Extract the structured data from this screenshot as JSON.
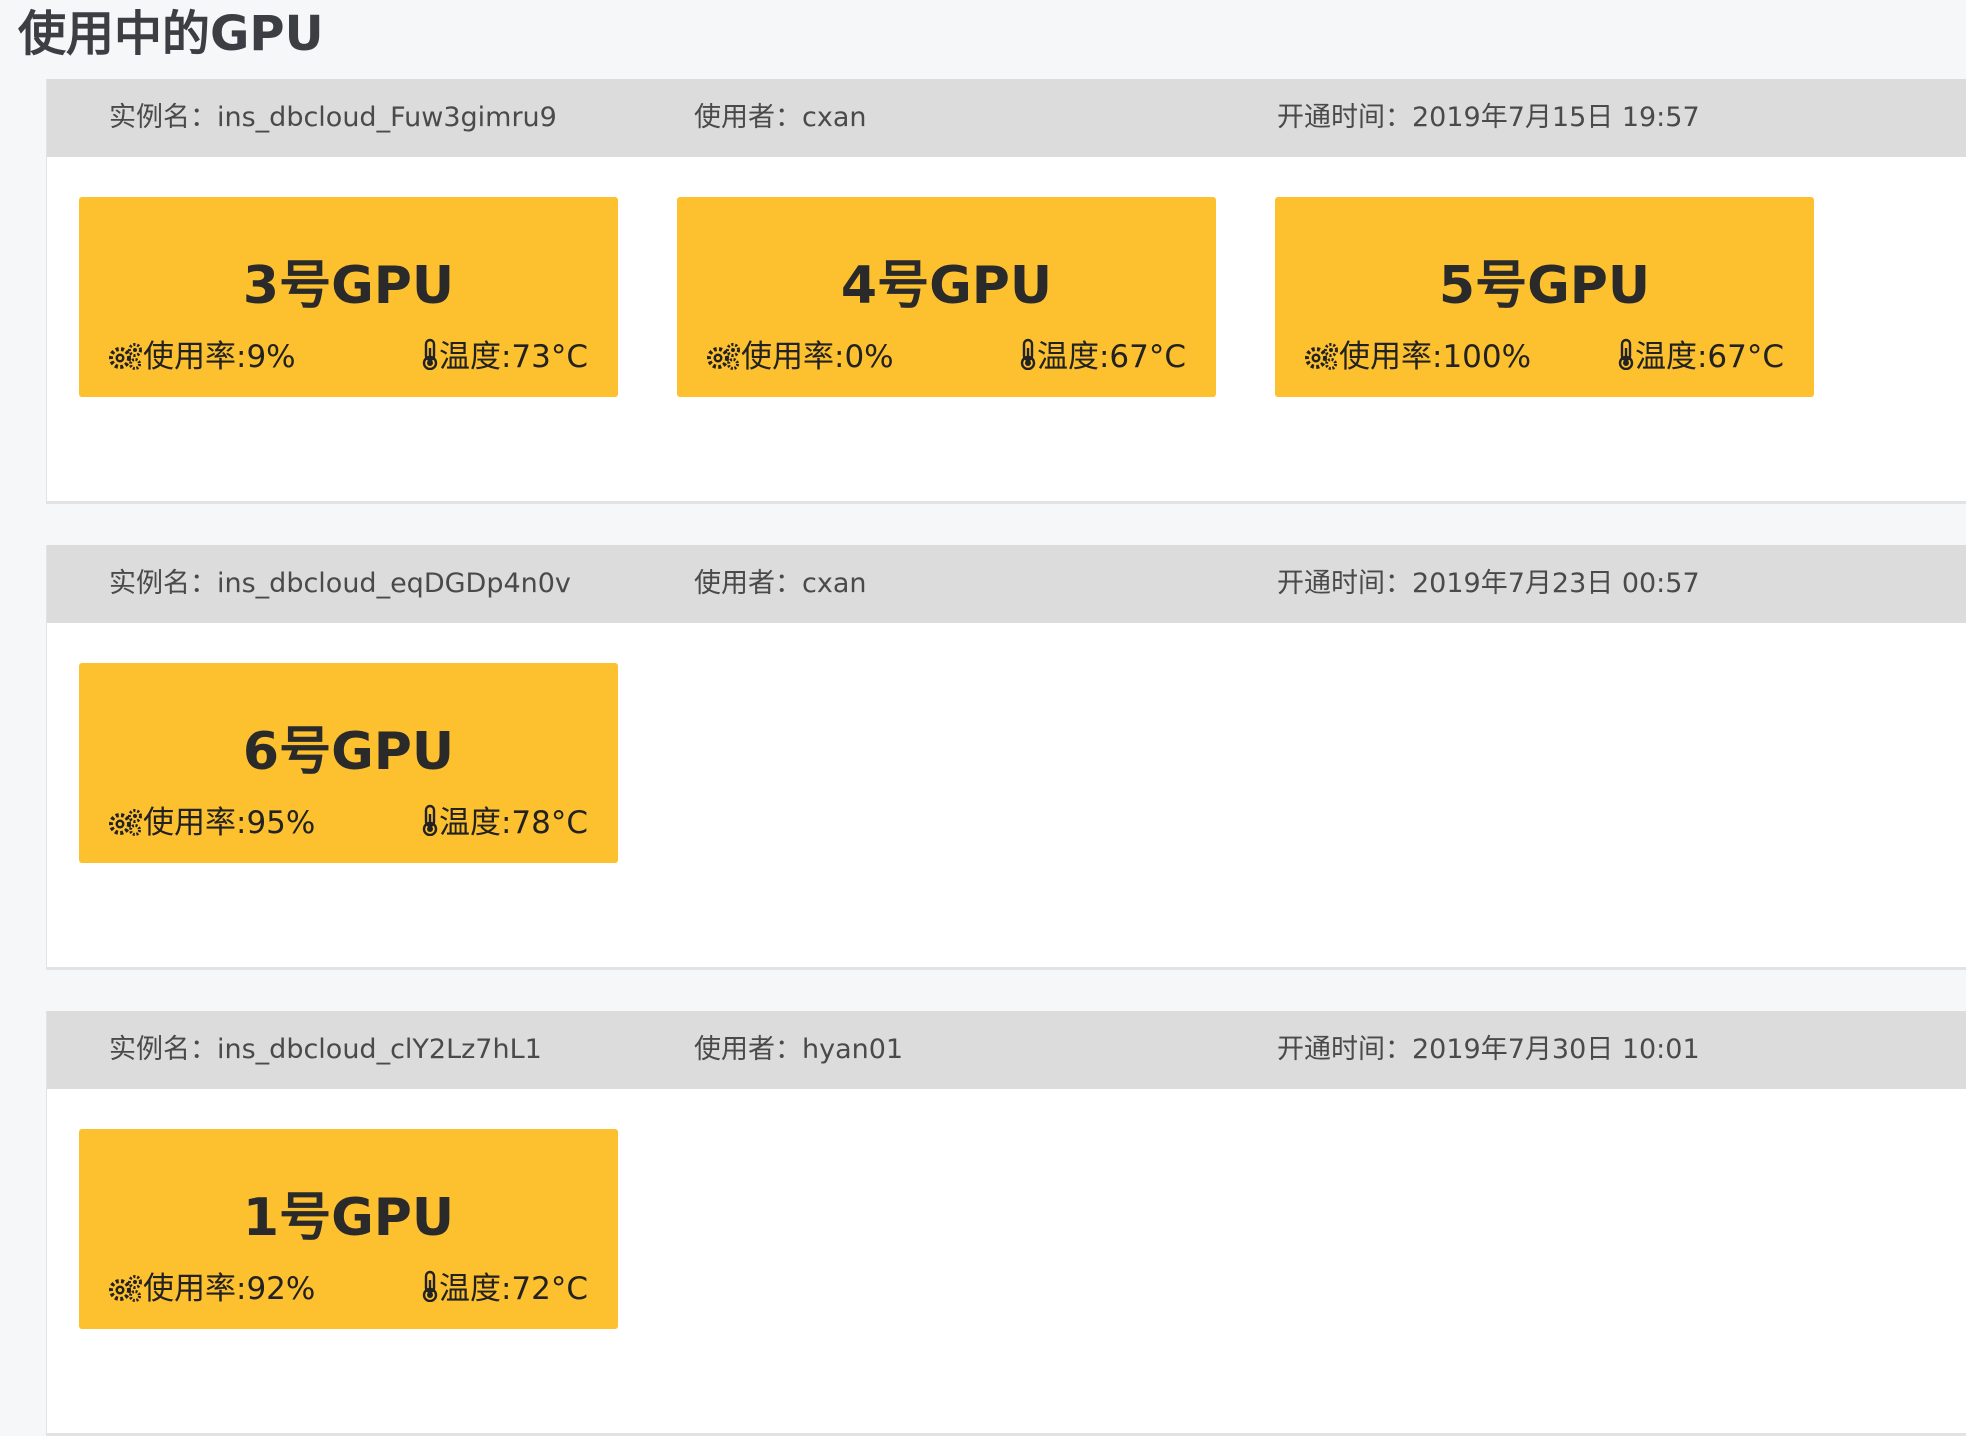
{
  "page": {
    "title": "使用中的GPU"
  },
  "labels": {
    "instance_name": "实例名：",
    "user": "使用者：",
    "open_time": "开通时间：",
    "usage": "使用率:",
    "temperature": "温度:"
  },
  "icons": {
    "usage": "gears-icon",
    "temperature": "thermometer-icon"
  },
  "colors": {
    "card": "#fdc02f",
    "header": "#dcdcdc"
  },
  "instances": [
    {
      "name": "ins_dbcloud_Fuw3gimru9",
      "user": "cxan",
      "time": "2019年7月15日 19:57",
      "gpus": [
        {
          "name": "3号GPU",
          "usage": "9%",
          "temp": "73°C"
        },
        {
          "name": "4号GPU",
          "usage": "0%",
          "temp": "67°C"
        },
        {
          "name": "5号GPU",
          "usage": "100%",
          "temp": "67°C"
        }
      ]
    },
    {
      "name": "ins_dbcloud_eqDGDp4n0v",
      "user": "cxan",
      "time": "2019年7月23日 00:57",
      "gpus": [
        {
          "name": "6号GPU",
          "usage": "95%",
          "temp": "78°C"
        }
      ]
    },
    {
      "name": "ins_dbcloud_clY2Lz7hL1",
      "user": "hyan01",
      "time": "2019年7月30日 10:01",
      "gpus": [
        {
          "name": "1号GPU",
          "usage": "92%",
          "temp": "72°C"
        }
      ]
    }
  ]
}
